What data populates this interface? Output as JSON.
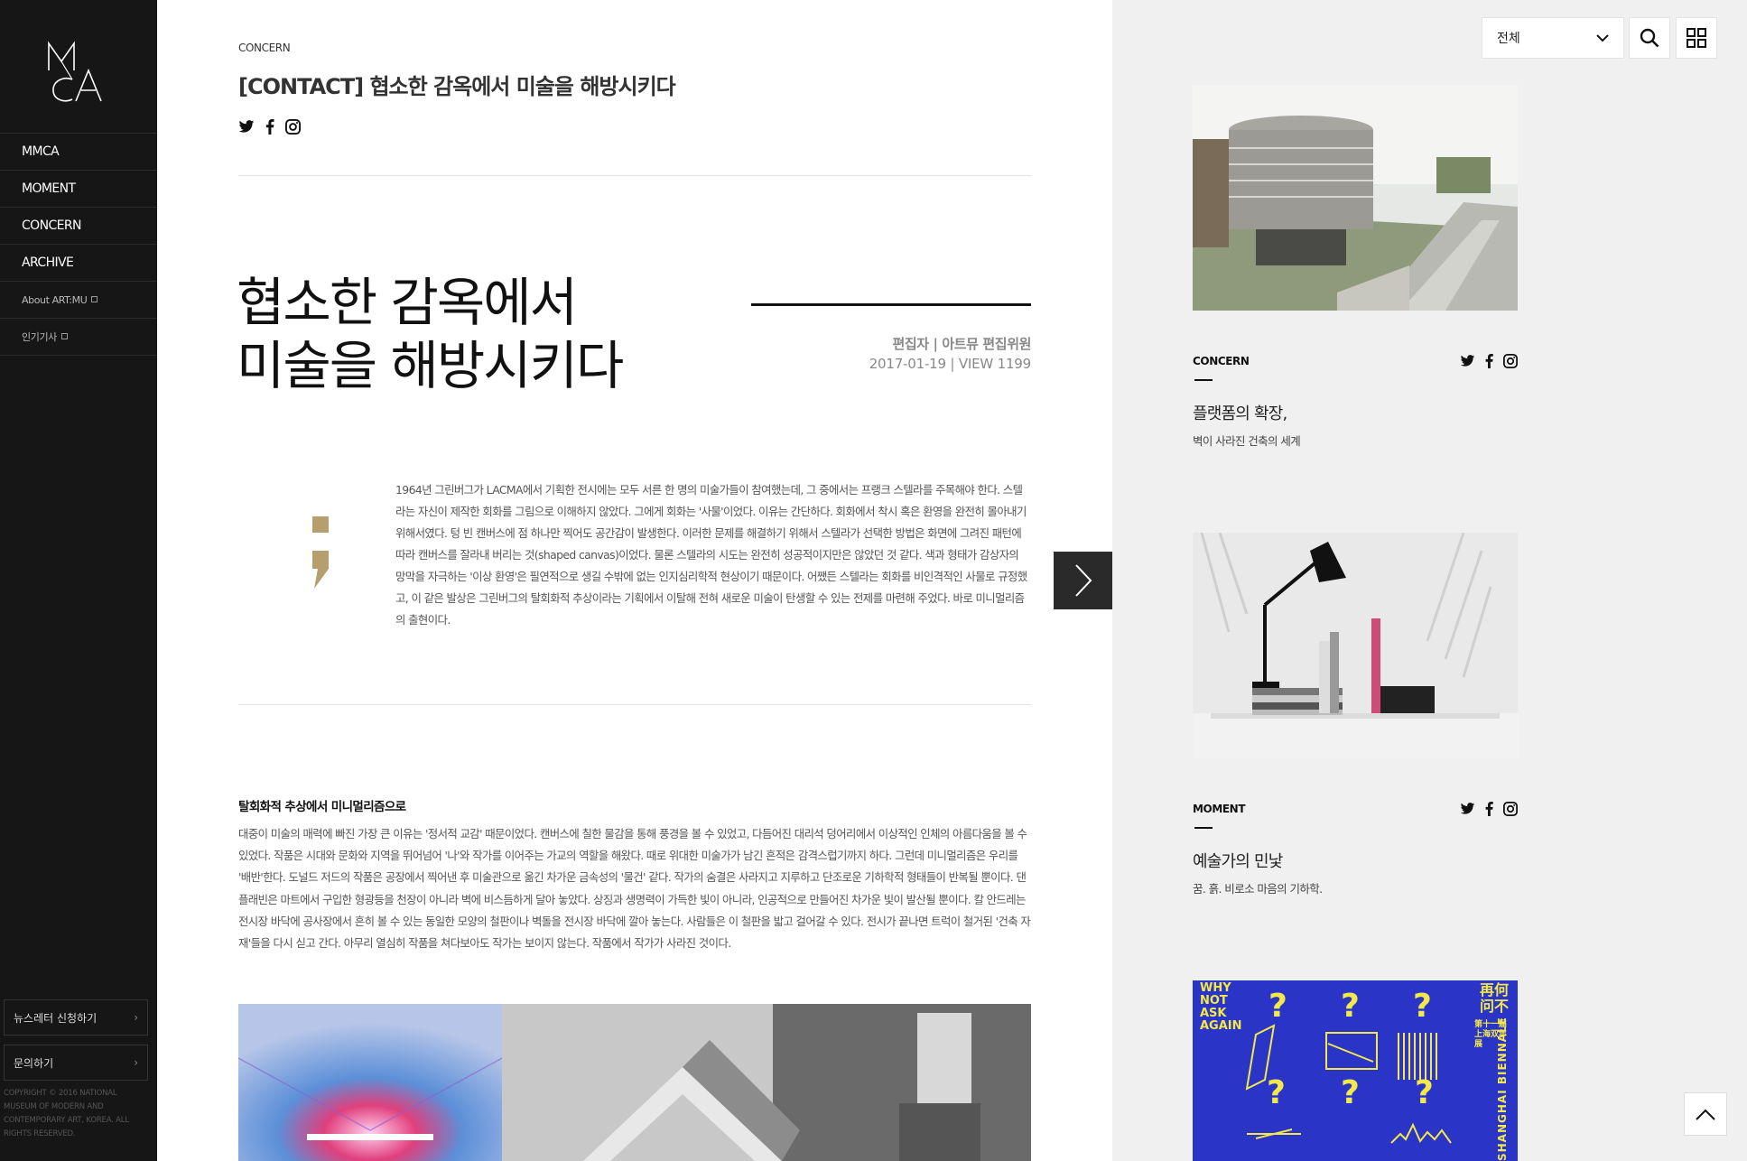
{
  "sidebar": {
    "logo_text": "MMCA",
    "nav": [
      {
        "label": "MMCA"
      },
      {
        "label": "MOMENT"
      },
      {
        "label": "CONCERN"
      },
      {
        "label": "ARCHIVE"
      },
      {
        "label": "About ART:MU"
      },
      {
        "label": "인기기사"
      }
    ],
    "newsletter_label": "뉴스레터 신청하기",
    "contact_label": "문의하기",
    "chevron": "›",
    "copyright": "COPYRIGHT © 2016 NATIONAL MUSEUM OF MODERN AND CONTEMPORARY ART, KOREA. ALL RIGHTS RESERVED."
  },
  "article": {
    "category": "CONCERN",
    "title": "[CONTACT] 협소한 감옥에서 미술을 해방시키다",
    "hero_line1": "협소한 감옥에서",
    "hero_line2": "미술을 해방시키다",
    "author": "편집자 | 아트뮤 편집위원",
    "meta": "2017-01-19 | VIEW 1199",
    "lead": " 1964년 그린버그가 LACMA에서 기획한 전시에는 모두 서른 한 명의 미술가들이 참여했는데, 그 중에서는 프랭크 스텔라를 주목해야 한다. 스텔라는 자신이 제작한 회화를 그림으로 이해하지 않았다. 그에게 회화는 '사물'이었다. 이유는 간단하다. 회화에서 착시 혹은 환영을 완전히 몰아내기 위해서였다. 텅 빈 캔버스에 점 하나만 찍어도 공간감이 발생한다. 이러한 문제를 해결하기 위해서 스텔라가 선택한 방법은 화면에 그려진 패턴에 따라 캔버스를 잘라내 버리는 것(shaped canvas)이었다. 물론 스텔라의 시도는 완전히 성공적이지만은 않았던 것 같다. 색과 형태가 감상자의 망막을 자극하는 '이상 환영'은 필연적으로 생길 수밖에 없는 인지심리학적 현상이기 때문이다. 어쨌든 스텔라는 회화를 비인격적인 사물로 규정했고, 이 같은 발상은 그린버그의 탈회화적 추상이라는 기획에서 이탈해 전혀 새로운 미술이 탄생할 수 있는 전제를 마련해 주었다. 바로 미니멀리즘의 출현이다.",
    "section_heading": "탈회화적 추상에서 미니멀리즘으로",
    "body": "대중이 미술의 매력에 빠진 가장 큰 이유는 '정서적 교감' 때문이었다. 캔버스에 칠한 물감을 통해 풍경을 볼 수 있었고, 다듬어진 대리석 덩어리에서 이상적인 인체의 아름다움을 볼 수 있었다. 작품은 시대와 문화와 지역을 뛰어넘어 '나'와 작가를 이어주는 가교의 역할을 해왔다. 때로 위대한 미술가가 남긴 흔적은 감격스럽기까지 하다. 그런데 미니멀리즘은 우리를 '배반'한다. 도널드 저드의 작품은 공장에서 찍어낸 후 미술관으로 옮긴 차가운 금속성의 '물건' 같다. 작가의 숨결은 사라지고 지루하고 단조로운 기하학적 형태들이 반복될 뿐이다. 댄 플래빈은 마트에서 구입한 형광등을 천장이 아니라 벽에 비스듬하게 달아 놓았다. 상징과 생명력이 가득한 빛이 아니라, 인공적으로 만들어진 차가운 빛이 발산될 뿐이다. 칼 안드레는 전시장 바닥에 공사장에서 흔히 볼 수 있는 동일한 모양의 철판이나 벽돌을 전시장 바닥에 깔아 놓는다. 사람들은 이 철판을 밟고 걸어갈 수 있다. 전시가 끝나면 트럭이 철거된 '건축 자재'들을 다시 싣고 간다. 아무리 열심히 작품을 쳐다보아도 작가는 보이지 않는다. 작품에서 작가가 사라진 것이다."
  },
  "filter": {
    "selected": "전체"
  },
  "cards": [
    {
      "category": "CONCERN",
      "title": "플랫폼의 확장,",
      "subtitle": "벽이 사라진 건축의 세계"
    },
    {
      "category": "MOMENT",
      "title": "예술가의 민낯",
      "subtitle": "꿈. 흙. 비로소 마음의 기하학."
    },
    {
      "category": "",
      "title": "",
      "subtitle": "",
      "poster_text_left": "WHY NOT ASK AGAIN",
      "poster_text_right": "再何问不",
      "poster_small": "第十一届上海双年展",
      "poster_vertical": "SHANGHAI BIENNALE"
    }
  ],
  "colors": {
    "sidebar_bg": "#161616",
    "accent_gold": "#b59f6c",
    "right_bg": "#f0f0f0",
    "poster_blue": "#2a35c8"
  }
}
